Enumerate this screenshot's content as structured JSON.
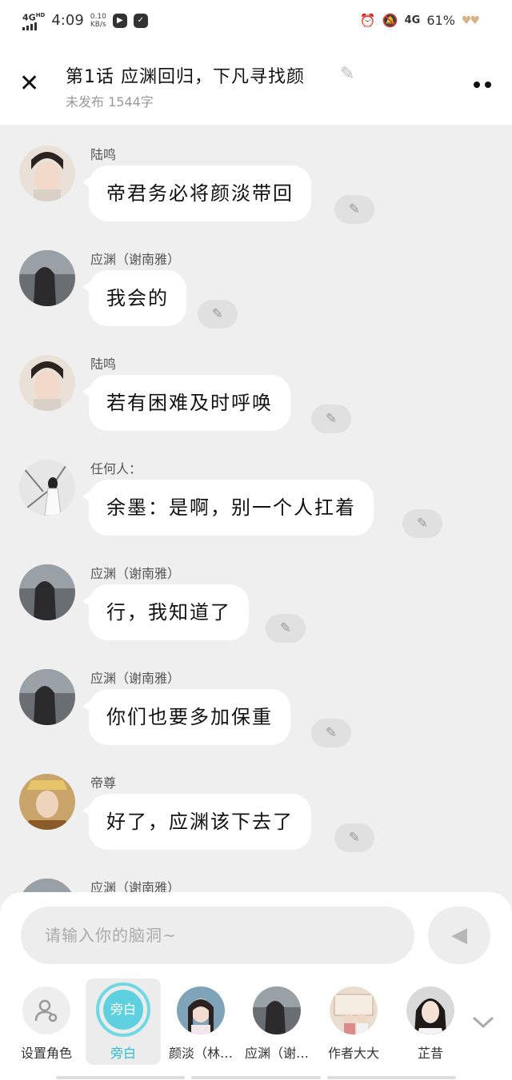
{
  "status_bar": {
    "network": "4G",
    "network_sup": "HD",
    "time": "4:09",
    "speed_value": "0.10",
    "speed_unit": "KB/s",
    "network_right": "4G",
    "battery": "61%"
  },
  "header": {
    "title": "第1话 应渊回归，下凡寻找颜",
    "subtitle": "未发布 1544字"
  },
  "messages": [
    {
      "name": "陆鸣",
      "text": "帝君务必将颜淡带回"
    },
    {
      "name": "应渊（谢南雅）",
      "text": "我会的"
    },
    {
      "name": "陆鸣",
      "text": "若有困难及时呼唤"
    },
    {
      "name": "任何人：",
      "text": "余墨：是啊，别一个人扛着"
    },
    {
      "name": "应渊（谢南雅）",
      "text": "行，我知道了"
    },
    {
      "name": "应渊（谢南雅）",
      "text": "你们也要多加保重"
    },
    {
      "name": "帝尊",
      "text": "好了，应渊该下去了"
    },
    {
      "name": "应渊（谢南雅）",
      "text": ""
    }
  ],
  "composer": {
    "placeholder": "请输入你的脑洞~"
  },
  "roles": [
    {
      "label": "设置角色"
    },
    {
      "label": "旁白",
      "badge": "旁白"
    },
    {
      "label": "颜淡（林…"
    },
    {
      "label": "应渊（谢…"
    },
    {
      "label": "作者大大"
    },
    {
      "label": "芷昔"
    }
  ],
  "colors": {
    "accent": "#2bbdd0",
    "bubble": "#ffffff",
    "background": "#efefef"
  }
}
